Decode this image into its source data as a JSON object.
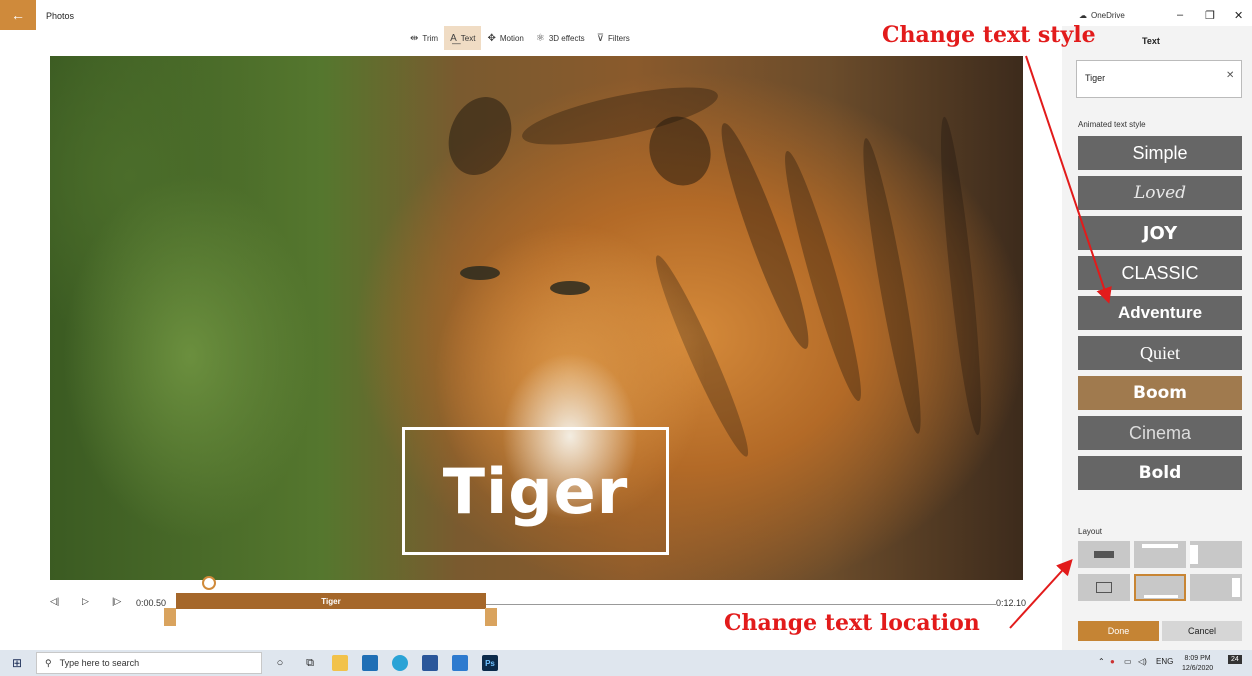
{
  "window": {
    "app_title": "Photos",
    "onedrive_label": "OneDrive",
    "back_icon": "arrow-left-icon"
  },
  "toolbar": {
    "items": [
      {
        "label": "Trim",
        "icon": "trim-icon",
        "active": false
      },
      {
        "label": "Text",
        "icon": "text-icon",
        "active": true
      },
      {
        "label": "Motion",
        "icon": "motion-icon",
        "active": false
      },
      {
        "label": "3D effects",
        "icon": "3d-effects-icon",
        "active": false
      },
      {
        "label": "Filters",
        "icon": "filters-icon",
        "active": false
      }
    ]
  },
  "video": {
    "overlay_text": "Tiger"
  },
  "timeline": {
    "current_time": "0:00.50",
    "end_time": "0:12.10",
    "clip_label": "Tiger"
  },
  "panel": {
    "title": "Text",
    "text_value": "Tiger",
    "animated_style_label": "Animated text style",
    "styles": [
      "Simple",
      "Loved",
      "JOY",
      "CLASSIC",
      "Adventure",
      "Quiet",
      "Boom",
      "Cinema",
      "Bold"
    ],
    "selected_style": "Boom",
    "layout_label": "Layout",
    "done_label": "Done",
    "cancel_label": "Cancel"
  },
  "annotations": {
    "style_note": "Change text style",
    "location_note": "Change text location"
  },
  "taskbar": {
    "search_placeholder": "Type here to search",
    "language": "ENG",
    "time": "8:09 PM",
    "date": "12/6/2020",
    "notification_count": "24"
  },
  "colors": {
    "accent": "#c58434",
    "annotation": "#e21b1b",
    "style_tile": "#666666",
    "style_selected": "#a07a4e"
  }
}
